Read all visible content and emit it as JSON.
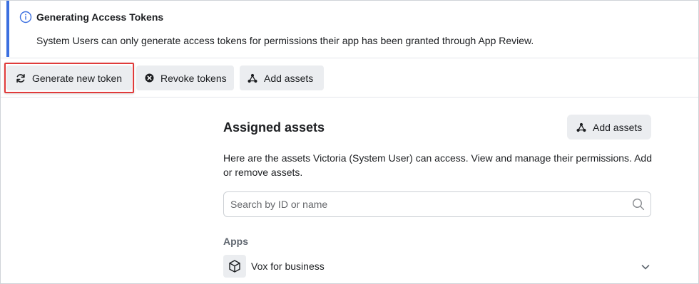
{
  "banner": {
    "title": "Generating Access Tokens",
    "text": "System Users can only generate access tokens for permissions their app has been granted through App Review.",
    "icon": "info-icon",
    "accent_color": "#3b6fe0"
  },
  "toolbar": {
    "generate_label": "Generate new token",
    "generate_icon": "refresh-icon",
    "revoke_label": "Revoke tokens",
    "revoke_icon": "close-circle-icon",
    "add_assets_label": "Add assets",
    "add_assets_icon": "nodes-icon",
    "highlight_color": "#e03a3a"
  },
  "assets": {
    "title": "Assigned assets",
    "add_label": "Add assets",
    "description": "Here are the assets Victoria (System User) can access. View and manage their permissions. Add or remove assets.",
    "search_placeholder": "Search by ID or name",
    "apps_heading": "Apps",
    "apps": [
      {
        "name": "Vox for business",
        "icon": "cube-icon"
      }
    ]
  }
}
